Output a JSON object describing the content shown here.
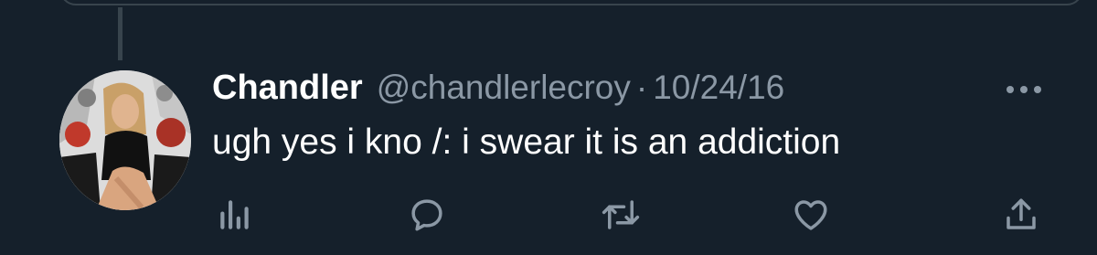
{
  "tweet": {
    "display_name": "Chandler",
    "handle": "@chandlerlecroy",
    "separator": "·",
    "date": "10/24/16",
    "text": "ugh yes i kno /: i swear it is an addiction"
  },
  "actions": [
    {
      "name": "views",
      "icon": "bar-chart-icon"
    },
    {
      "name": "reply",
      "icon": "speech-bubble-icon"
    },
    {
      "name": "retweet",
      "icon": "retweet-icon"
    },
    {
      "name": "like",
      "icon": "heart-icon"
    },
    {
      "name": "share",
      "icon": "share-upload-icon"
    }
  ],
  "colors": {
    "background": "#15202b",
    "muted_text": "#8b98a5",
    "primary_text": "#ffffff",
    "divider": "#38444d"
  }
}
